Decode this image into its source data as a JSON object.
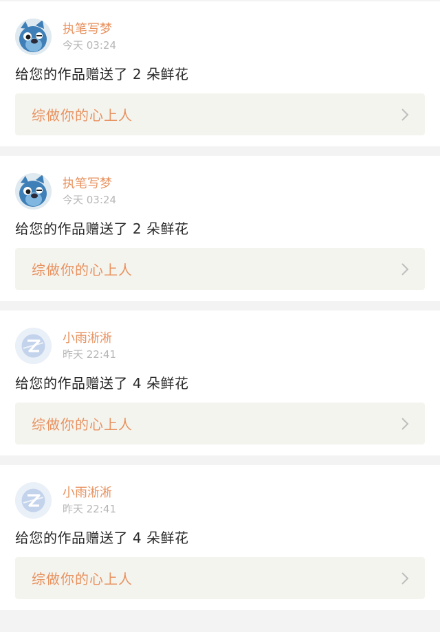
{
  "notifications": [
    {
      "user_name": "执笔写梦",
      "avatar_type": "cartoon",
      "time": "今天 03:24",
      "message": "给您的作品赠送了 2 朵鲜花",
      "work_title": "综做你的心上人"
    },
    {
      "user_name": "执笔写梦",
      "avatar_type": "cartoon",
      "time": "今天 03:24",
      "message": "给您的作品赠送了 2 朵鲜花",
      "work_title": "综做你的心上人"
    },
    {
      "user_name": "小雨淅淅",
      "avatar_type": "default",
      "time": "昨天 22:41",
      "message": "给您的作品赠送了 4 朵鲜花",
      "work_title": "综做你的心上人"
    },
    {
      "user_name": "小雨淅淅",
      "avatar_type": "default",
      "time": "昨天 22:41",
      "message": "给您的作品赠送了 4 朵鲜花",
      "work_title": "综做你的心上人"
    }
  ],
  "colors": {
    "accent": "#e8915e",
    "link_bg": "#f4f4ef",
    "page_bg": "#f3f3f3",
    "muted_text": "#b6b6b6"
  },
  "icons": {
    "chevron": "chevron-right-icon",
    "default_avatar": "default-avatar-icon",
    "cartoon_avatar": "cartoon-avatar-icon"
  }
}
